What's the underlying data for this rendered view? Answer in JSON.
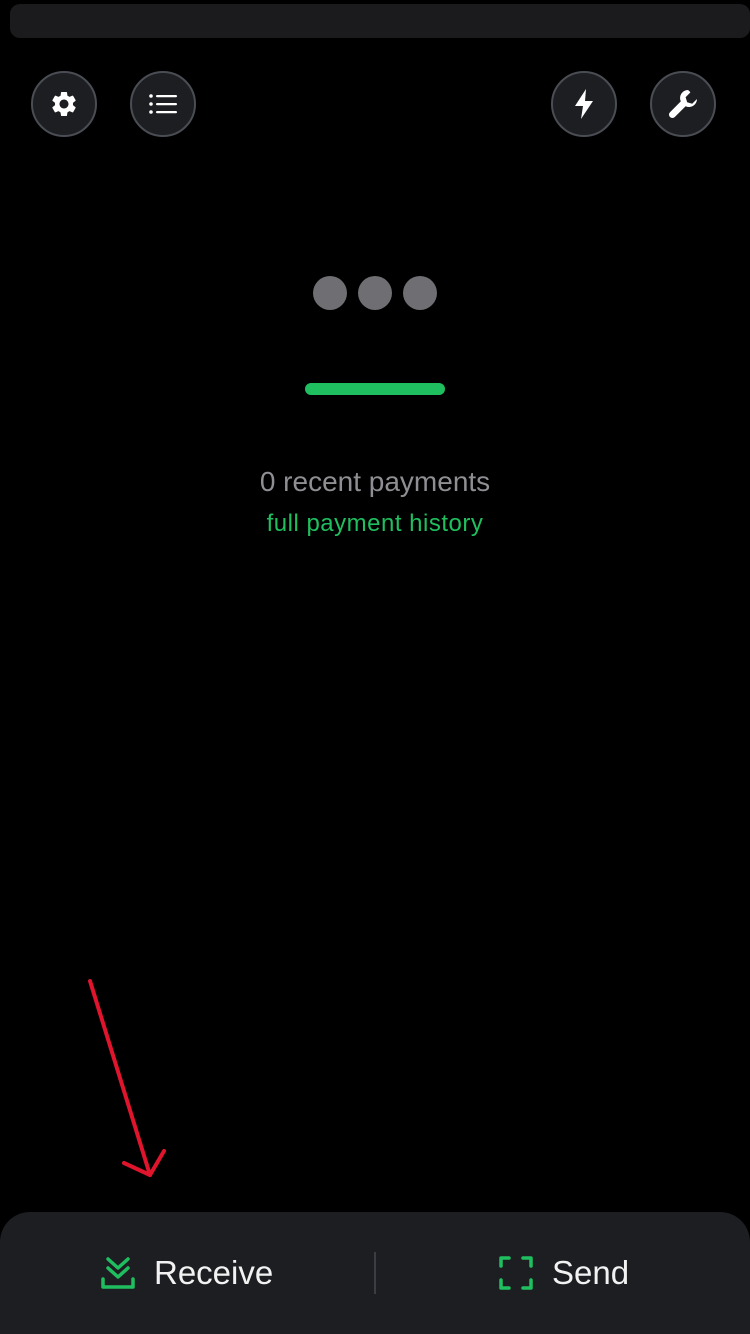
{
  "top_bar": {
    "buttons": [
      {
        "name": "settings",
        "icon": "gear-icon"
      },
      {
        "name": "list",
        "icon": "list-icon"
      },
      {
        "name": "lightning",
        "icon": "lightning-icon"
      },
      {
        "name": "tools",
        "icon": "wrench-icon"
      }
    ]
  },
  "balance": {
    "masked": true
  },
  "payments": {
    "recent_count_text": "0 recent payments",
    "history_link": "full payment history"
  },
  "bottom_bar": {
    "receive_label": "Receive",
    "send_label": "Send"
  },
  "colors": {
    "accent": "#1fbf5f",
    "background": "#000000",
    "surface": "#1c1e22",
    "muted_text": "#8e8e93",
    "annotation_arrow": "#e0142c"
  }
}
